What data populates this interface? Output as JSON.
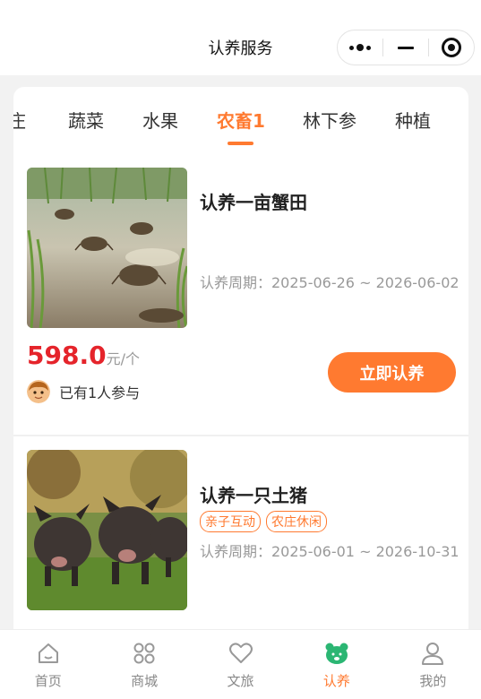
{
  "header": {
    "title": "认养服务"
  },
  "tabs": [
    {
      "label": "庄"
    },
    {
      "label": "蔬菜"
    },
    {
      "label": "水果"
    },
    {
      "label": "农畜1"
    },
    {
      "label": "林下参"
    },
    {
      "label": "种植"
    }
  ],
  "active_tab": "农畜1",
  "cards": [
    {
      "title": "认养一亩蟹田",
      "period": "认养周期：2025-06-26 ~ 2026-06-02",
      "price": "598.0",
      "unit": "元/个",
      "button": "立即认养",
      "participants": "已有1人参与",
      "tags": []
    },
    {
      "title": "认养一只土猪",
      "period": "认养周期：2025-06-01 ~ 2026-10-31",
      "tags": [
        "亲子互动",
        "农庄休闲"
      ]
    }
  ],
  "tabbar": [
    {
      "label": "首页",
      "icon": "home-icon"
    },
    {
      "label": "商城",
      "icon": "grid-icon"
    },
    {
      "label": "文旅",
      "icon": "heart-icon"
    },
    {
      "label": "认养",
      "icon": "bear-icon"
    },
    {
      "label": "我的",
      "icon": "user-icon"
    }
  ],
  "colors": {
    "accent": "#ff7a30",
    "price": "#e5242b"
  }
}
